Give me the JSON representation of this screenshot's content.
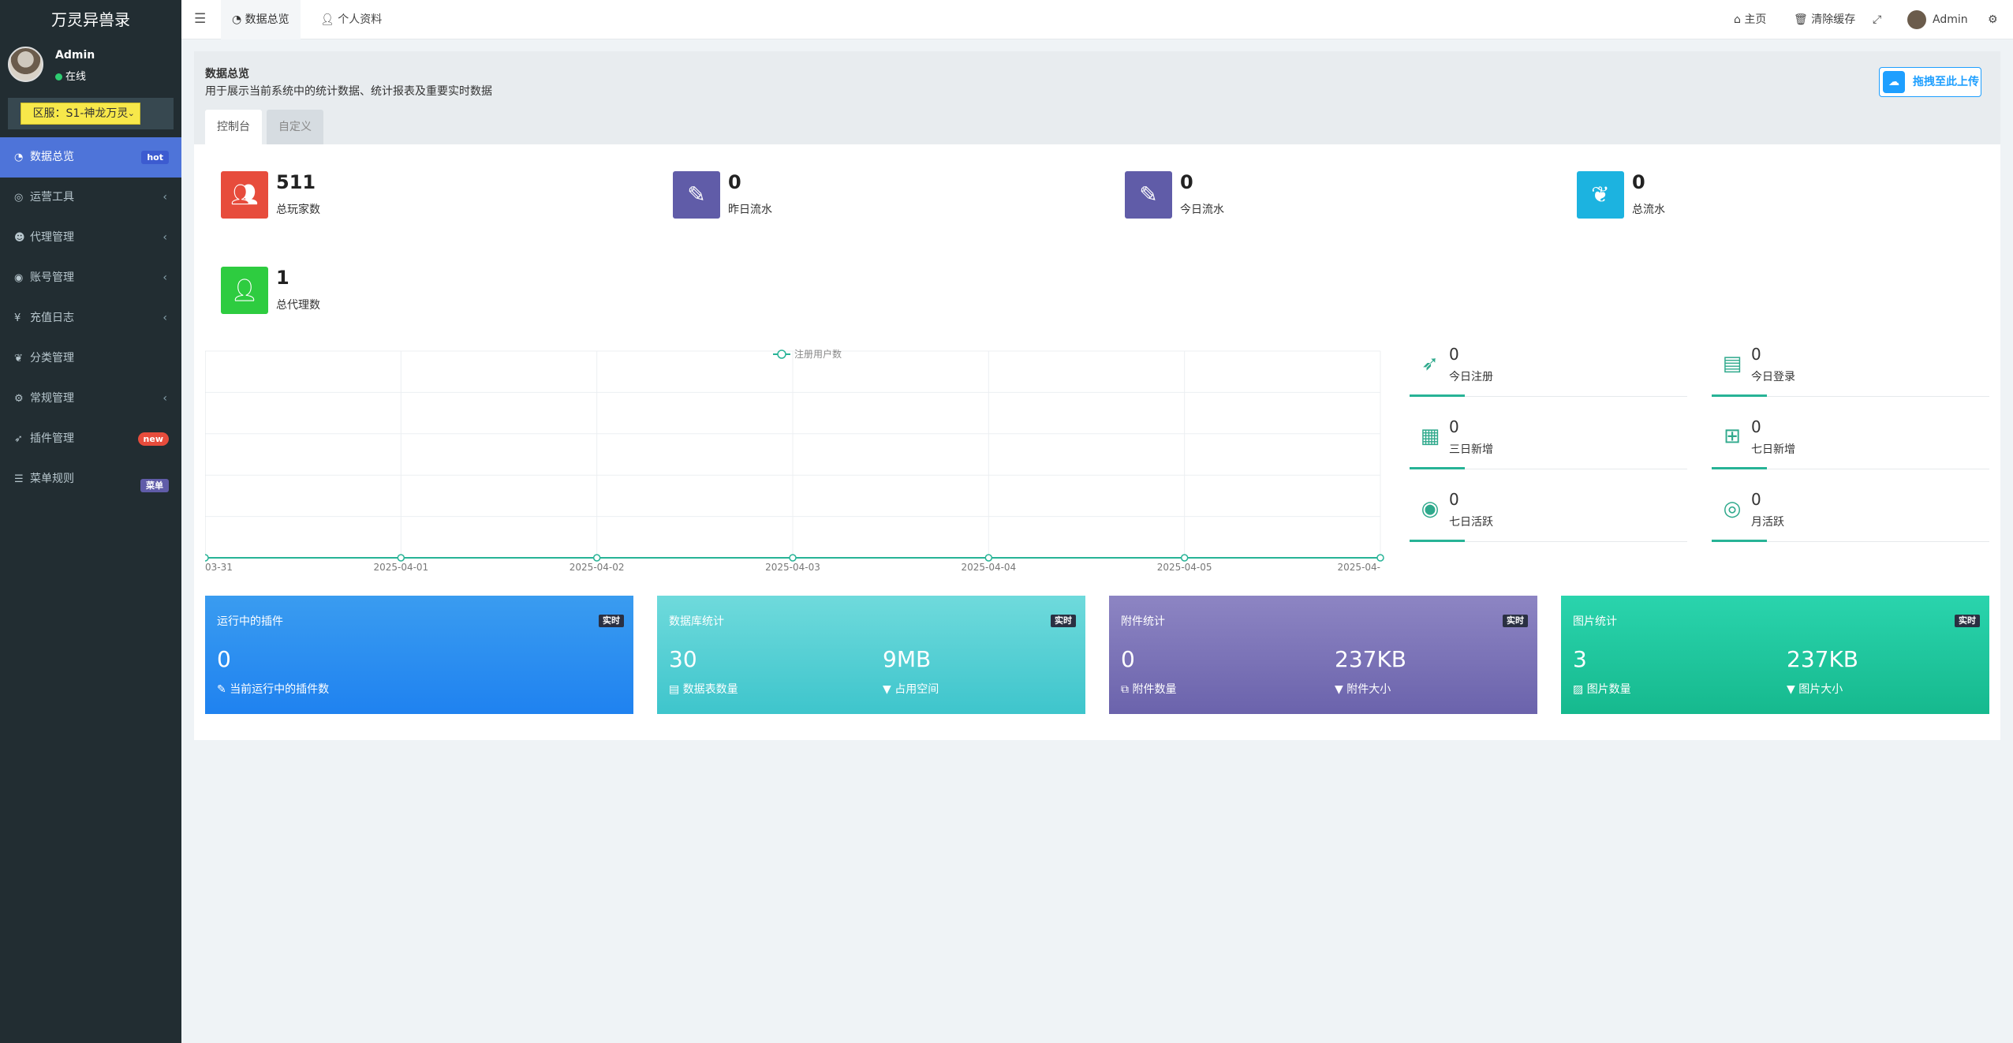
{
  "sidebar": {
    "brand": "万灵异兽录",
    "user": {
      "name": "Admin",
      "status": "在线"
    },
    "server_select": "区服：S1-神龙万灵",
    "items": [
      {
        "label": "数据总览",
        "icon": "dashboard-icon",
        "badge": "hot",
        "active": true
      },
      {
        "label": "运营工具",
        "icon": "gamepad-icon"
      },
      {
        "label": "代理管理",
        "icon": "users-icon"
      },
      {
        "label": "账号管理",
        "icon": "user-circle-icon"
      },
      {
        "label": "充值日志",
        "icon": "yen-icon"
      },
      {
        "label": "分类管理",
        "icon": "leaf-icon"
      },
      {
        "label": "常规管理",
        "icon": "cogs-icon"
      },
      {
        "label": "插件管理",
        "icon": "rocket-icon",
        "badge": "new"
      },
      {
        "label": "菜单规则",
        "icon": "list-icon",
        "badge": "菜单"
      }
    ]
  },
  "topbar": {
    "tabs": [
      "数据总览",
      "个人资料"
    ],
    "right": {
      "home": "主页",
      "clear_cache": "清除缓存",
      "user": "Admin"
    }
  },
  "header": {
    "title": "数据总览",
    "description": "用于展示当前系统中的统计数据、统计报表及重要实时数据",
    "upload": "拖拽至此上传",
    "tabs": [
      "控制台",
      "自定义"
    ]
  },
  "stats": [
    {
      "value": "511",
      "label": "总玩家数",
      "color": "#e74c3c",
      "icon": "users-icon"
    },
    {
      "value": "0",
      "label": "昨日流水",
      "color": "#605ca8",
      "icon": "magic-icon"
    },
    {
      "value": "0",
      "label": "今日流水",
      "color": "#605ca8",
      "icon": "magic-icon"
    },
    {
      "value": "0",
      "label": "总流水",
      "color": "#1cb3e0",
      "icon": "leaf-icon"
    },
    {
      "value": "1",
      "label": "总代理数",
      "color": "#2ecc40",
      "icon": "user-icon"
    }
  ],
  "chart_data": {
    "type": "line",
    "legend": "注册用户数",
    "x": [
      "03-31",
      "2025-04-01",
      "2025-04-02",
      "2025-04-03",
      "2025-04-04",
      "2025-04-05",
      "2025-04-"
    ],
    "series": [
      {
        "name": "注册用户数",
        "values": [
          0,
          0,
          0,
          0,
          0,
          0,
          0
        ]
      }
    ],
    "color": "#27b396"
  },
  "mini_stats": [
    {
      "value": "0",
      "label": "今日注册",
      "icon": "rocket-icon"
    },
    {
      "value": "0",
      "label": "今日登录",
      "icon": "id-card-icon"
    },
    {
      "value": "0",
      "label": "三日新增",
      "icon": "calendar-icon"
    },
    {
      "value": "0",
      "label": "七日新增",
      "icon": "calendar-plus-icon"
    },
    {
      "value": "0",
      "label": "七日活跃",
      "icon": "user-circle-icon"
    },
    {
      "value": "0",
      "label": "月活跃",
      "icon": "user-circle-outline-icon"
    }
  ],
  "cards": [
    {
      "title": "运行中的插件",
      "badge": "实时",
      "v1": "0",
      "l1": "当前运行中的插件数",
      "v2": "",
      "l2": ""
    },
    {
      "title": "数据库统计",
      "badge": "实时",
      "v1": "30",
      "l1": "数据表数量",
      "v2": "9MB",
      "l2": "占用空间"
    },
    {
      "title": "附件统计",
      "badge": "实时",
      "v1": "0",
      "l1": "附件数量",
      "v2": "237KB",
      "l2": "附件大小"
    },
    {
      "title": "图片统计",
      "badge": "实时",
      "v1": "3",
      "l1": "图片数量",
      "v2": "237KB",
      "l2": "图片大小"
    }
  ]
}
